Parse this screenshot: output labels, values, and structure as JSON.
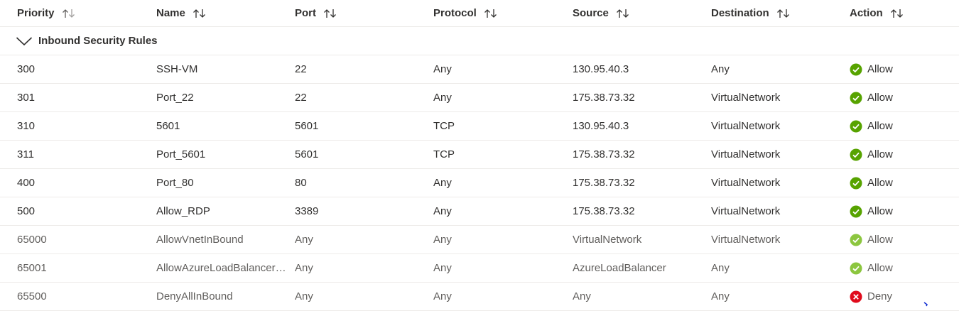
{
  "columns": [
    "Priority",
    "Name",
    "Port",
    "Protocol",
    "Source",
    "Destination",
    "Action"
  ],
  "group": {
    "label": "Inbound Security Rules"
  },
  "rows": [
    {
      "priority": "300",
      "name": "SSH-VM",
      "port": "22",
      "protocol": "Any",
      "source": "130.95.40.3",
      "destination": "Any",
      "action": "Allow"
    },
    {
      "priority": "301",
      "name": "Port_22",
      "port": "22",
      "protocol": "Any",
      "source": "175.38.73.32",
      "destination": "VirtualNetwork",
      "action": "Allow"
    },
    {
      "priority": "310",
      "name": "5601",
      "port": "5601",
      "protocol": "TCP",
      "source": "130.95.40.3",
      "destination": "VirtualNetwork",
      "action": "Allow"
    },
    {
      "priority": "311",
      "name": "Port_5601",
      "port": "5601",
      "protocol": "TCP",
      "source": "175.38.73.32",
      "destination": "VirtualNetwork",
      "action": "Allow"
    },
    {
      "priority": "400",
      "name": "Port_80",
      "port": "80",
      "protocol": "Any",
      "source": "175.38.73.32",
      "destination": "VirtualNetwork",
      "action": "Allow"
    },
    {
      "priority": "500",
      "name": "Allow_RDP",
      "port": "3389",
      "protocol": "Any",
      "source": "175.38.73.32",
      "destination": "VirtualNetwork",
      "action": "Allow"
    },
    {
      "priority": "65000",
      "name": "AllowVnetInBound",
      "port": "Any",
      "protocol": "Any",
      "source": "VirtualNetwork",
      "destination": "VirtualNetwork",
      "action": "Allow"
    },
    {
      "priority": "65001",
      "name": "AllowAzureLoadBalancerInBound",
      "port": "Any",
      "protocol": "Any",
      "source": "AzureLoadBalancer",
      "destination": "Any",
      "action": "Allow"
    },
    {
      "priority": "65500",
      "name": "DenyAllInBound",
      "port": "Any",
      "protocol": "Any",
      "source": "Any",
      "destination": "Any",
      "action": "Deny"
    }
  ],
  "colors": {
    "allow": "#57a300",
    "allow_default": "#8cc63f",
    "deny": "#e00b1c",
    "text": "#323130",
    "text_default": "#605e5c",
    "divider": "#edebe9"
  },
  "icons": {
    "sort": "sort-arrows-icon",
    "group_toggle": "chevron-down-icon",
    "allow": "checkmark-circle-icon",
    "deny": "error-circle-icon"
  }
}
